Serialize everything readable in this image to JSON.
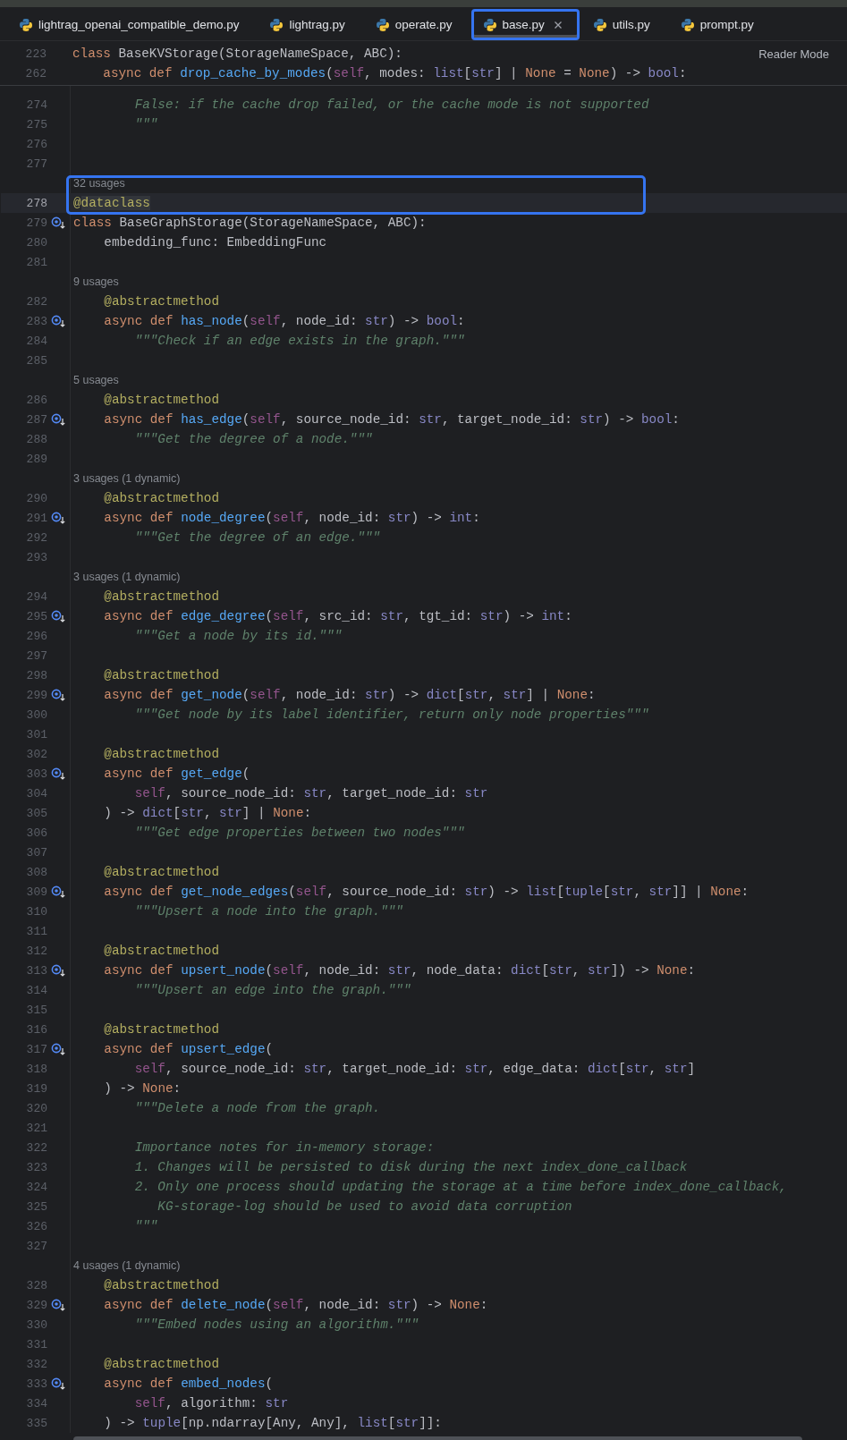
{
  "tabs": [
    {
      "label": "lightrag_openai_compatible_demo.py",
      "selected": false,
      "outlined": false
    },
    {
      "label": "lightrag.py",
      "selected": false,
      "outlined": false
    },
    {
      "label": "operate.py",
      "selected": false,
      "outlined": false
    },
    {
      "label": "base.py",
      "selected": true,
      "outlined": true
    },
    {
      "label": "utils.py",
      "selected": false,
      "outlined": false
    },
    {
      "label": "prompt.py",
      "selected": false,
      "outlined": false
    }
  ],
  "sticky_header": {
    "reader_mode": "Reader Mode",
    "lines": [
      {
        "number": "223",
        "tokens": [
          {
            "kind": "kw",
            "text": "class "
          },
          {
            "kind": "plain",
            "text": "BaseKVStorage(StorageNameSpace, ABC):"
          }
        ]
      },
      {
        "number": "262",
        "tokens": [
          {
            "kind": "kw",
            "text": "    async def "
          },
          {
            "kind": "fn",
            "text": "drop_cache_by_modes"
          },
          {
            "kind": "plain",
            "text": "("
          },
          {
            "kind": "self",
            "text": "self"
          },
          {
            "kind": "plain",
            "text": ", modes: "
          },
          {
            "kind": "type",
            "text": "list"
          },
          {
            "kind": "plain",
            "text": "["
          },
          {
            "kind": "type",
            "text": "str"
          },
          {
            "kind": "plain",
            "text": "] | "
          },
          {
            "kind": "kw",
            "text": "None"
          },
          {
            "kind": "plain",
            "text": " = "
          },
          {
            "kind": "kw",
            "text": "None"
          },
          {
            "kind": "plain",
            "text": ") -> "
          },
          {
            "kind": "type",
            "text": "bool"
          },
          {
            "kind": "plain",
            "text": ":"
          }
        ]
      }
    ]
  },
  "editor": {
    "rows": [
      {
        "kind": "code",
        "number": "274",
        "marker": false,
        "tokens": [
          {
            "kind": "doc",
            "text": "        False: if the cache drop failed, or the cache mode is not supported"
          }
        ]
      },
      {
        "kind": "code",
        "number": "275",
        "marker": false,
        "tokens": [
          {
            "kind": "doc",
            "text": "        \"\"\""
          }
        ]
      },
      {
        "kind": "code",
        "number": "276",
        "marker": false,
        "tokens": []
      },
      {
        "kind": "code",
        "number": "277",
        "marker": false,
        "tokens": []
      },
      {
        "kind": "callout",
        "rows": [
          {
            "kind": "usage",
            "text": "32 usages"
          },
          {
            "kind": "current",
            "number": "278",
            "marker": false,
            "tokens": [
              {
                "kind": "deco",
                "text": "@"
              },
              {
                "kind": "hl",
                "text": "dataclass"
              }
            ]
          }
        ]
      },
      {
        "kind": "code",
        "number": "279",
        "marker": true,
        "tokens": [
          {
            "kind": "kw",
            "text": "class "
          },
          {
            "kind": "plain",
            "text": "BaseGraphStorage(StorageNameSpace, ABC):"
          }
        ]
      },
      {
        "kind": "code",
        "number": "280",
        "marker": false,
        "tokens": [
          {
            "kind": "plain",
            "text": "    embedding_func: EmbeddingFunc"
          }
        ]
      },
      {
        "kind": "code",
        "number": "281",
        "marker": false,
        "tokens": []
      },
      {
        "kind": "usage",
        "text": "9 usages"
      },
      {
        "kind": "code",
        "number": "282",
        "marker": false,
        "tokens": [
          {
            "kind": "deco",
            "text": "    @abstractmethod"
          }
        ]
      },
      {
        "kind": "code",
        "number": "283",
        "marker": true,
        "tokens": [
          {
            "kind": "kw",
            "text": "    async def "
          },
          {
            "kind": "fn",
            "text": "has_node"
          },
          {
            "kind": "plain",
            "text": "("
          },
          {
            "kind": "self",
            "text": "self"
          },
          {
            "kind": "plain",
            "text": ", node_id: "
          },
          {
            "kind": "type",
            "text": "str"
          },
          {
            "kind": "plain",
            "text": ") -> "
          },
          {
            "kind": "type",
            "text": "bool"
          },
          {
            "kind": "plain",
            "text": ":"
          }
        ]
      },
      {
        "kind": "code",
        "number": "284",
        "marker": false,
        "tokens": [
          {
            "kind": "doc",
            "text": "        \"\"\"Check if an edge exists in the graph.\"\"\""
          }
        ]
      },
      {
        "kind": "code",
        "number": "285",
        "marker": false,
        "tokens": []
      },
      {
        "kind": "usage",
        "text": "5 usages"
      },
      {
        "kind": "code",
        "number": "286",
        "marker": false,
        "tokens": [
          {
            "kind": "deco",
            "text": "    @abstractmethod"
          }
        ]
      },
      {
        "kind": "code",
        "number": "287",
        "marker": true,
        "tokens": [
          {
            "kind": "kw",
            "text": "    async def "
          },
          {
            "kind": "fn",
            "text": "has_edge"
          },
          {
            "kind": "plain",
            "text": "("
          },
          {
            "kind": "self",
            "text": "self"
          },
          {
            "kind": "plain",
            "text": ", source_node_id: "
          },
          {
            "kind": "type",
            "text": "str"
          },
          {
            "kind": "plain",
            "text": ", target_node_id: "
          },
          {
            "kind": "type",
            "text": "str"
          },
          {
            "kind": "plain",
            "text": ") -> "
          },
          {
            "kind": "type",
            "text": "bool"
          },
          {
            "kind": "plain",
            "text": ":"
          }
        ]
      },
      {
        "kind": "code",
        "number": "288",
        "marker": false,
        "tokens": [
          {
            "kind": "doc",
            "text": "        \"\"\"Get the degree of a node.\"\"\""
          }
        ]
      },
      {
        "kind": "code",
        "number": "289",
        "marker": false,
        "tokens": []
      },
      {
        "kind": "usage",
        "text": "3 usages (1 dynamic)"
      },
      {
        "kind": "code",
        "number": "290",
        "marker": false,
        "tokens": [
          {
            "kind": "deco",
            "text": "    @abstractmethod"
          }
        ]
      },
      {
        "kind": "code",
        "number": "291",
        "marker": true,
        "tokens": [
          {
            "kind": "kw",
            "text": "    async def "
          },
          {
            "kind": "fn",
            "text": "node_degree"
          },
          {
            "kind": "plain",
            "text": "("
          },
          {
            "kind": "self",
            "text": "self"
          },
          {
            "kind": "plain",
            "text": ", node_id: "
          },
          {
            "kind": "type",
            "text": "str"
          },
          {
            "kind": "plain",
            "text": ") -> "
          },
          {
            "kind": "type",
            "text": "int"
          },
          {
            "kind": "plain",
            "text": ":"
          }
        ]
      },
      {
        "kind": "code",
        "number": "292",
        "marker": false,
        "tokens": [
          {
            "kind": "doc",
            "text": "        \"\"\"Get the degree of an edge.\"\"\""
          }
        ]
      },
      {
        "kind": "code",
        "number": "293",
        "marker": false,
        "tokens": []
      },
      {
        "kind": "usage",
        "text": "3 usages (1 dynamic)"
      },
      {
        "kind": "code",
        "number": "294",
        "marker": false,
        "tokens": [
          {
            "kind": "deco",
            "text": "    @abstractmethod"
          }
        ]
      },
      {
        "kind": "code",
        "number": "295",
        "marker": true,
        "tokens": [
          {
            "kind": "kw",
            "text": "    async def "
          },
          {
            "kind": "fn",
            "text": "edge_degree"
          },
          {
            "kind": "plain",
            "text": "("
          },
          {
            "kind": "self",
            "text": "self"
          },
          {
            "kind": "plain",
            "text": ", src_id: "
          },
          {
            "kind": "type",
            "text": "str"
          },
          {
            "kind": "plain",
            "text": ", tgt_id: "
          },
          {
            "kind": "type",
            "text": "str"
          },
          {
            "kind": "plain",
            "text": ") -> "
          },
          {
            "kind": "type",
            "text": "int"
          },
          {
            "kind": "plain",
            "text": ":"
          }
        ]
      },
      {
        "kind": "code",
        "number": "296",
        "marker": false,
        "tokens": [
          {
            "kind": "doc",
            "text": "        \"\"\"Get a node by its id.\"\"\""
          }
        ]
      },
      {
        "kind": "code",
        "number": "297",
        "marker": false,
        "tokens": []
      },
      {
        "kind": "code",
        "number": "298",
        "marker": false,
        "tokens": [
          {
            "kind": "deco",
            "text": "    @abstractmethod"
          }
        ]
      },
      {
        "kind": "code",
        "number": "299",
        "marker": true,
        "tokens": [
          {
            "kind": "kw",
            "text": "    async def "
          },
          {
            "kind": "fn",
            "text": "get_node"
          },
          {
            "kind": "plain",
            "text": "("
          },
          {
            "kind": "self",
            "text": "self"
          },
          {
            "kind": "plain",
            "text": ", node_id: "
          },
          {
            "kind": "type",
            "text": "str"
          },
          {
            "kind": "plain",
            "text": ") -> "
          },
          {
            "kind": "type",
            "text": "dict"
          },
          {
            "kind": "plain",
            "text": "["
          },
          {
            "kind": "type",
            "text": "str"
          },
          {
            "kind": "plain",
            "text": ", "
          },
          {
            "kind": "type",
            "text": "str"
          },
          {
            "kind": "plain",
            "text": "] | "
          },
          {
            "kind": "kw",
            "text": "None"
          },
          {
            "kind": "plain",
            "text": ":"
          }
        ]
      },
      {
        "kind": "code",
        "number": "300",
        "marker": false,
        "tokens": [
          {
            "kind": "doc",
            "text": "        \"\"\"Get node by its label identifier, return only node properties\"\"\""
          }
        ]
      },
      {
        "kind": "code",
        "number": "301",
        "marker": false,
        "tokens": []
      },
      {
        "kind": "code",
        "number": "302",
        "marker": false,
        "tokens": [
          {
            "kind": "deco",
            "text": "    @abstractmethod"
          }
        ]
      },
      {
        "kind": "code",
        "number": "303",
        "marker": true,
        "tokens": [
          {
            "kind": "kw",
            "text": "    async def "
          },
          {
            "kind": "fn",
            "text": "get_edge"
          },
          {
            "kind": "plain",
            "text": "("
          }
        ]
      },
      {
        "kind": "code",
        "number": "304",
        "marker": false,
        "tokens": [
          {
            "kind": "self",
            "text": "        self"
          },
          {
            "kind": "plain",
            "text": ", source_node_id: "
          },
          {
            "kind": "type",
            "text": "str"
          },
          {
            "kind": "plain",
            "text": ", target_node_id: "
          },
          {
            "kind": "type",
            "text": "str"
          }
        ]
      },
      {
        "kind": "code",
        "number": "305",
        "marker": false,
        "tokens": [
          {
            "kind": "plain",
            "text": "    ) -> "
          },
          {
            "kind": "type",
            "text": "dict"
          },
          {
            "kind": "plain",
            "text": "["
          },
          {
            "kind": "type",
            "text": "str"
          },
          {
            "kind": "plain",
            "text": ", "
          },
          {
            "kind": "type",
            "text": "str"
          },
          {
            "kind": "plain",
            "text": "] | "
          },
          {
            "kind": "kw",
            "text": "None"
          },
          {
            "kind": "plain",
            "text": ":"
          }
        ]
      },
      {
        "kind": "code",
        "number": "306",
        "marker": false,
        "tokens": [
          {
            "kind": "doc",
            "text": "        \"\"\"Get edge properties between two nodes\"\"\""
          }
        ]
      },
      {
        "kind": "code",
        "number": "307",
        "marker": false,
        "tokens": []
      },
      {
        "kind": "code",
        "number": "308",
        "marker": false,
        "tokens": [
          {
            "kind": "deco",
            "text": "    @abstractmethod"
          }
        ]
      },
      {
        "kind": "code",
        "number": "309",
        "marker": true,
        "tokens": [
          {
            "kind": "kw",
            "text": "    async def "
          },
          {
            "kind": "fn",
            "text": "get_node_edges"
          },
          {
            "kind": "plain",
            "text": "("
          },
          {
            "kind": "self",
            "text": "self"
          },
          {
            "kind": "plain",
            "text": ", source_node_id: "
          },
          {
            "kind": "type",
            "text": "str"
          },
          {
            "kind": "plain",
            "text": ") -> "
          },
          {
            "kind": "type",
            "text": "list"
          },
          {
            "kind": "plain",
            "text": "["
          },
          {
            "kind": "type",
            "text": "tuple"
          },
          {
            "kind": "plain",
            "text": "["
          },
          {
            "kind": "type",
            "text": "str"
          },
          {
            "kind": "plain",
            "text": ", "
          },
          {
            "kind": "type",
            "text": "str"
          },
          {
            "kind": "plain",
            "text": "]] | "
          },
          {
            "kind": "kw",
            "text": "None"
          },
          {
            "kind": "plain",
            "text": ":"
          }
        ]
      },
      {
        "kind": "code",
        "number": "310",
        "marker": false,
        "tokens": [
          {
            "kind": "doc",
            "text": "        \"\"\"Upsert a node into the graph.\"\"\""
          }
        ]
      },
      {
        "kind": "code",
        "number": "311",
        "marker": false,
        "tokens": []
      },
      {
        "kind": "code",
        "number": "312",
        "marker": false,
        "tokens": [
          {
            "kind": "deco",
            "text": "    @abstractmethod"
          }
        ]
      },
      {
        "kind": "code",
        "number": "313",
        "marker": true,
        "tokens": [
          {
            "kind": "kw",
            "text": "    async def "
          },
          {
            "kind": "fn",
            "text": "upsert_node"
          },
          {
            "kind": "plain",
            "text": "("
          },
          {
            "kind": "self",
            "text": "self"
          },
          {
            "kind": "plain",
            "text": ", node_id: "
          },
          {
            "kind": "type",
            "text": "str"
          },
          {
            "kind": "plain",
            "text": ", node_data: "
          },
          {
            "kind": "type",
            "text": "dict"
          },
          {
            "kind": "plain",
            "text": "["
          },
          {
            "kind": "type",
            "text": "str"
          },
          {
            "kind": "plain",
            "text": ", "
          },
          {
            "kind": "type",
            "text": "str"
          },
          {
            "kind": "plain",
            "text": "]) -> "
          },
          {
            "kind": "kw",
            "text": "None"
          },
          {
            "kind": "plain",
            "text": ":"
          }
        ]
      },
      {
        "kind": "code",
        "number": "314",
        "marker": false,
        "tokens": [
          {
            "kind": "doc",
            "text": "        \"\"\"Upsert an edge into the graph.\"\"\""
          }
        ]
      },
      {
        "kind": "code",
        "number": "315",
        "marker": false,
        "tokens": []
      },
      {
        "kind": "code",
        "number": "316",
        "marker": false,
        "tokens": [
          {
            "kind": "deco",
            "text": "    @abstractmethod"
          }
        ]
      },
      {
        "kind": "code",
        "number": "317",
        "marker": true,
        "tokens": [
          {
            "kind": "kw",
            "text": "    async def "
          },
          {
            "kind": "fn",
            "text": "upsert_edge"
          },
          {
            "kind": "plain",
            "text": "("
          }
        ]
      },
      {
        "kind": "code",
        "number": "318",
        "marker": false,
        "tokens": [
          {
            "kind": "self",
            "text": "        self"
          },
          {
            "kind": "plain",
            "text": ", source_node_id: "
          },
          {
            "kind": "type",
            "text": "str"
          },
          {
            "kind": "plain",
            "text": ", target_node_id: "
          },
          {
            "kind": "type",
            "text": "str"
          },
          {
            "kind": "plain",
            "text": ", edge_data: "
          },
          {
            "kind": "type",
            "text": "dict"
          },
          {
            "kind": "plain",
            "text": "["
          },
          {
            "kind": "type",
            "text": "str"
          },
          {
            "kind": "plain",
            "text": ", "
          },
          {
            "kind": "type",
            "text": "str"
          },
          {
            "kind": "plain",
            "text": "]"
          }
        ]
      },
      {
        "kind": "code",
        "number": "319",
        "marker": false,
        "tokens": [
          {
            "kind": "plain",
            "text": "    ) -> "
          },
          {
            "kind": "kw",
            "text": "None"
          },
          {
            "kind": "plain",
            "text": ":"
          }
        ]
      },
      {
        "kind": "code",
        "number": "320",
        "marker": false,
        "tokens": [
          {
            "kind": "doc",
            "text": "        \"\"\"Delete a node from the graph."
          }
        ]
      },
      {
        "kind": "code",
        "number": "321",
        "marker": false,
        "tokens": []
      },
      {
        "kind": "code",
        "number": "322",
        "marker": false,
        "tokens": [
          {
            "kind": "doc",
            "text": "        Importance notes for in-memory storage:"
          }
        ]
      },
      {
        "kind": "code",
        "number": "323",
        "marker": false,
        "tokens": [
          {
            "kind": "doc",
            "text": "        1. Changes will be persisted to disk during the next index_done_callback"
          }
        ]
      },
      {
        "kind": "code",
        "number": "324",
        "marker": false,
        "tokens": [
          {
            "kind": "doc",
            "text": "        2. Only one process should updating the storage at a time before index_done_callback,"
          }
        ]
      },
      {
        "kind": "code",
        "number": "325",
        "marker": false,
        "tokens": [
          {
            "kind": "doc",
            "text": "           KG-storage-log should be used to avoid data corruption"
          }
        ]
      },
      {
        "kind": "code",
        "number": "326",
        "marker": false,
        "tokens": [
          {
            "kind": "doc",
            "text": "        \"\"\""
          }
        ]
      },
      {
        "kind": "code",
        "number": "327",
        "marker": false,
        "tokens": []
      },
      {
        "kind": "usage",
        "text": "4 usages (1 dynamic)"
      },
      {
        "kind": "code",
        "number": "328",
        "marker": false,
        "tokens": [
          {
            "kind": "deco",
            "text": "    @abstractmethod"
          }
        ]
      },
      {
        "kind": "code",
        "number": "329",
        "marker": true,
        "tokens": [
          {
            "kind": "kw",
            "text": "    async def "
          },
          {
            "kind": "fn",
            "text": "delete_node"
          },
          {
            "kind": "plain",
            "text": "("
          },
          {
            "kind": "self",
            "text": "self"
          },
          {
            "kind": "plain",
            "text": ", node_id: "
          },
          {
            "kind": "type",
            "text": "str"
          },
          {
            "kind": "plain",
            "text": ") -> "
          },
          {
            "kind": "kw",
            "text": "None"
          },
          {
            "kind": "plain",
            "text": ":"
          }
        ]
      },
      {
        "kind": "code",
        "number": "330",
        "marker": false,
        "tokens": [
          {
            "kind": "doc",
            "text": "        \"\"\"Embed nodes using an algorithm.\"\"\""
          }
        ]
      },
      {
        "kind": "code",
        "number": "331",
        "marker": false,
        "tokens": []
      },
      {
        "kind": "code",
        "number": "332",
        "marker": false,
        "tokens": [
          {
            "kind": "deco",
            "text": "    @abstractmethod"
          }
        ]
      },
      {
        "kind": "code",
        "number": "333",
        "marker": true,
        "tokens": [
          {
            "kind": "kw",
            "text": "    async def "
          },
          {
            "kind": "fn",
            "text": "embed_nodes"
          },
          {
            "kind": "plain",
            "text": "("
          }
        ]
      },
      {
        "kind": "code",
        "number": "334",
        "marker": false,
        "tokens": [
          {
            "kind": "self",
            "text": "        self"
          },
          {
            "kind": "plain",
            "text": ", algorithm: "
          },
          {
            "kind": "type",
            "text": "str"
          }
        ]
      },
      {
        "kind": "code",
        "number": "335",
        "marker": false,
        "tokens": [
          {
            "kind": "plain",
            "text": "    ) -> "
          },
          {
            "kind": "type",
            "text": "tuple"
          },
          {
            "kind": "plain",
            "text": "[np.ndarray[Any, Any], "
          },
          {
            "kind": "type",
            "text": "list"
          },
          {
            "kind": "plain",
            "text": "["
          },
          {
            "kind": "type",
            "text": "str"
          },
          {
            "kind": "plain",
            "text": "]]:"
          }
        ]
      }
    ]
  }
}
